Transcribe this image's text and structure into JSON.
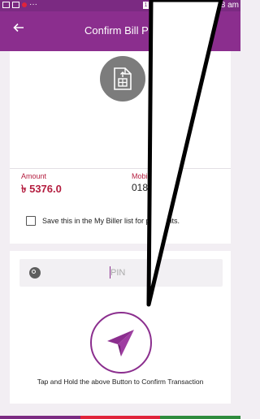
{
  "status_bar": {
    "dots": "···",
    "sim_label": "1",
    "time": "8 am"
  },
  "app_bar": {
    "title": "Confirm Bill Payment",
    "back_icon": "arrow-left-icon"
  },
  "biller": {
    "logo_icon": "document-upload-icon"
  },
  "payment": {
    "amount_label": "Amount",
    "amount_value": "৳ 5376.0",
    "mobile_label": "Mobile Number",
    "mobile_value": "018  600"
  },
  "save_option": {
    "text": "Save this in the My Biller list for payments.",
    "checked": false
  },
  "pin": {
    "placeholder": "PIN",
    "icon": "key-icon"
  },
  "confirm": {
    "button_icon": "send-plane-icon",
    "hint": "Tap and Hold the above Button to Confirm Transaction"
  },
  "colors": {
    "brand": "#8b2e8e",
    "accent_red": "#b41d3f",
    "stripe": [
      "#7b2a82",
      "#e0233b",
      "#2e8b3d"
    ]
  }
}
